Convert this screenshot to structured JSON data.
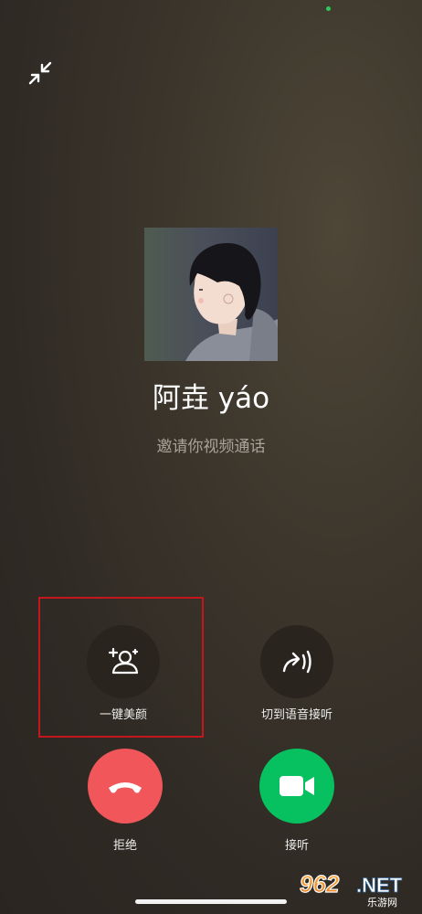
{
  "caller": {
    "name": "阿垚 yáo",
    "status": "邀请你视频通话"
  },
  "actions": {
    "beauty": {
      "label": "一键美颜",
      "icon": "face-sparkle-icon"
    },
    "switch_voice": {
      "label": "切到语音接听",
      "icon": "voice-switch-icon"
    },
    "decline": {
      "label": "拒绝",
      "icon": "hangup-icon",
      "color": "#f0565a"
    },
    "accept": {
      "label": "接听",
      "icon": "video-camera-icon",
      "color": "#07c160"
    }
  },
  "watermark": {
    "text": "962.NET",
    "subtext": "乐游网"
  },
  "colors": {
    "indicator_dot": "#2ec95c",
    "highlight_box": "#c4161c"
  }
}
